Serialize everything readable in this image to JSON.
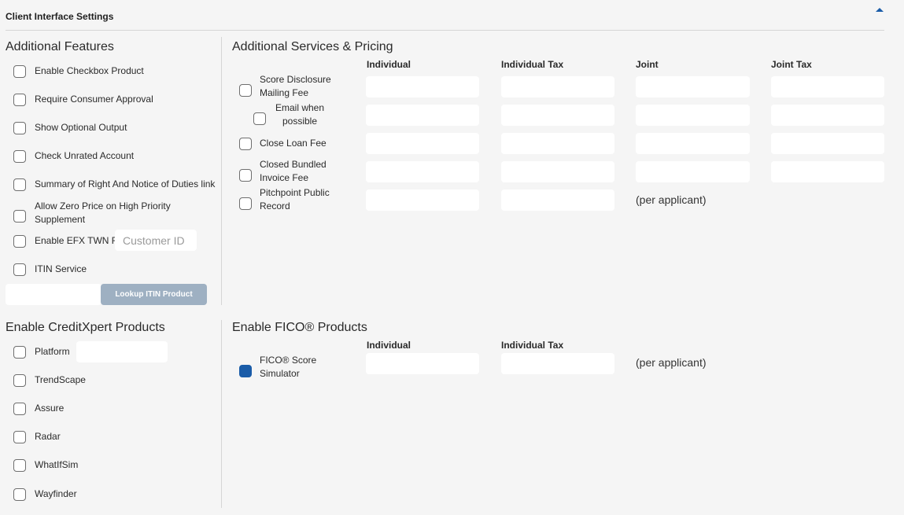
{
  "header": {
    "title": "Client Interface Settings",
    "collapse_icon": "caret-up-icon"
  },
  "additional_features": {
    "title": "Additional Features",
    "items": [
      {
        "label": "Enable Checkbox Product"
      },
      {
        "label": "Require Consumer Approval"
      },
      {
        "label": "Show Optional Output"
      },
      {
        "label": "Check Unrated Account"
      },
      {
        "label": "Summary of Right And Notice of Duties link"
      },
      {
        "label": "Allow Zero Price on High Priority Supplement"
      },
      {
        "label": "Enable EFX TWN RI",
        "input_placeholder": "Customer ID"
      },
      {
        "label": "ITIN Service"
      }
    ],
    "lookup_button": "Lookup ITIN Product"
  },
  "services": {
    "title": "Additional Services & Pricing",
    "columns": [
      "Individual",
      "Individual Tax",
      "Joint",
      "Joint Tax"
    ],
    "rows": [
      {
        "label": "Score Disclosure Mailing Fee"
      },
      {
        "label": "Email when possible"
      },
      {
        "label": "Close Loan Fee"
      },
      {
        "label": "Closed Bundled Invoice Fee"
      },
      {
        "label": "Pitchpoint Public Record",
        "note": "(per applicant)"
      }
    ]
  },
  "creditxpert": {
    "title": "Enable CreditXpert Products",
    "items": [
      {
        "label": "Platform"
      },
      {
        "label": "TrendScape"
      },
      {
        "label": "Assure"
      },
      {
        "label": "Radar"
      },
      {
        "label": "WhatIfSim"
      },
      {
        "label": "Wayfinder"
      }
    ]
  },
  "fico": {
    "title": "Enable FICO® Products",
    "columns": [
      "Individual",
      "Individual Tax"
    ],
    "rows": [
      {
        "label": "FICO® Score Simulator",
        "checked": true,
        "note": "(per applicant)"
      }
    ]
  },
  "colors": {
    "accent": "#1a5ca8",
    "button_disabled": "#9eb0c2",
    "background": "#f5f5f5"
  }
}
